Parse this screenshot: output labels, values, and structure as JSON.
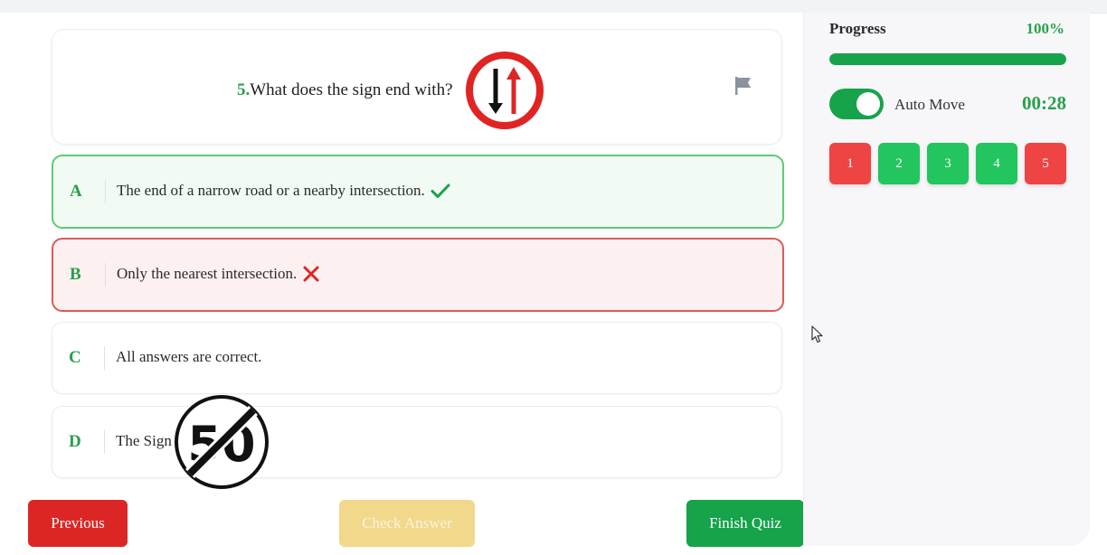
{
  "question": {
    "number": "5.",
    "text": "What does the sign end with?",
    "sign_icon": "two-way-traffic-sign-icon"
  },
  "options": [
    {
      "letter": "A",
      "text": "The end of a narrow road or a nearby intersection.",
      "state": "correct"
    },
    {
      "letter": "B",
      "text": "Only the nearest intersection.",
      "state": "wrong"
    },
    {
      "letter": "C",
      "text": "All answers are correct.",
      "state": "none"
    },
    {
      "letter": "D",
      "text": "The Sign",
      "state": "none",
      "sign_icon": "end-speed-limit-50-sign-icon",
      "sign_text": "50"
    }
  ],
  "buttons": {
    "previous": "Previous",
    "check": "Check Answer",
    "finish": "Finish Quiz"
  },
  "sidebar": {
    "progress_label": "Progress",
    "progress_value": "100%",
    "progress_fraction": 1.0,
    "auto_move_label": "Auto Move",
    "auto_move_on": true,
    "timer": "00:28",
    "question_nav": [
      {
        "label": "1",
        "status": "wrong"
      },
      {
        "label": "2",
        "status": "correct"
      },
      {
        "label": "3",
        "status": "correct"
      },
      {
        "label": "4",
        "status": "correct"
      },
      {
        "label": "5",
        "status": "wrong"
      }
    ]
  },
  "colors": {
    "green": "#16a34a",
    "red": "#dc2626",
    "disabled_yellow": "#f2d88a"
  }
}
